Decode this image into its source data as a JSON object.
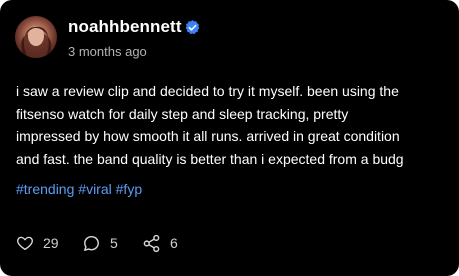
{
  "post": {
    "username": "noahhbennett",
    "verified_icon": "verified-badge-icon",
    "timestamp": "3 months ago",
    "body_lines": [
      "i saw a review clip and decided to try it myself. been using the",
      "fitsenso watch for daily step and sleep tracking, pretty",
      "impressed by how smooth it all runs. arrived in great condition",
      "and fast. the band quality is better than i expected from a budg"
    ],
    "hashtags": [
      "#trending",
      "#viral",
      "#fyp"
    ]
  },
  "actions": {
    "likes": {
      "icon": "heart-icon",
      "count": "29"
    },
    "comments": {
      "icon": "comment-icon",
      "count": "5"
    },
    "shares": {
      "icon": "share-icon",
      "count": "6"
    }
  },
  "colors": {
    "background": "#000000",
    "text": "#ffffff",
    "muted": "#b3b3b3",
    "hashtag": "#5b9cf5",
    "verified": "#3b82f6"
  }
}
